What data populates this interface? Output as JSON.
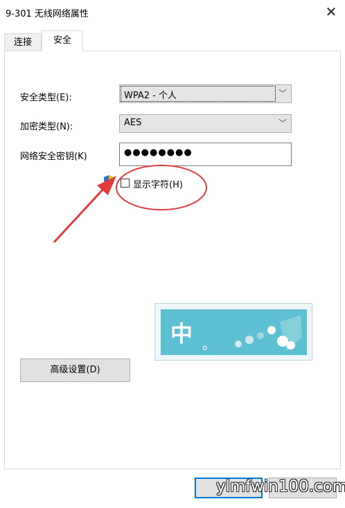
{
  "window": {
    "title": "9-301 无线网络属性"
  },
  "tabs": {
    "connection": "连接",
    "security": "安全"
  },
  "form": {
    "security_type_label": "安全类型(E):",
    "security_type_value": "WPA2 - 个人",
    "encryption_type_label": "加密类型(N):",
    "encryption_type_value": "AES",
    "key_label": "网络安全密钥(K)",
    "key_value": "●●●●●●●●",
    "show_chars_label": "显示字符(H)",
    "show_chars_checked": false
  },
  "buttons": {
    "advanced": "高级设置(D)"
  },
  "ime_popup": {
    "char": "中",
    "extra": "。"
  },
  "watermark": {
    "text": "ylmfwin100.com"
  },
  "colors": {
    "annotation": "#e23b3b",
    "ime_accent": "#5ec1d3",
    "focus": "#0078d7"
  },
  "icons": [
    "close-icon",
    "uac-shield-icon",
    "chevron-down-icon",
    "checkbox-icon"
  ]
}
